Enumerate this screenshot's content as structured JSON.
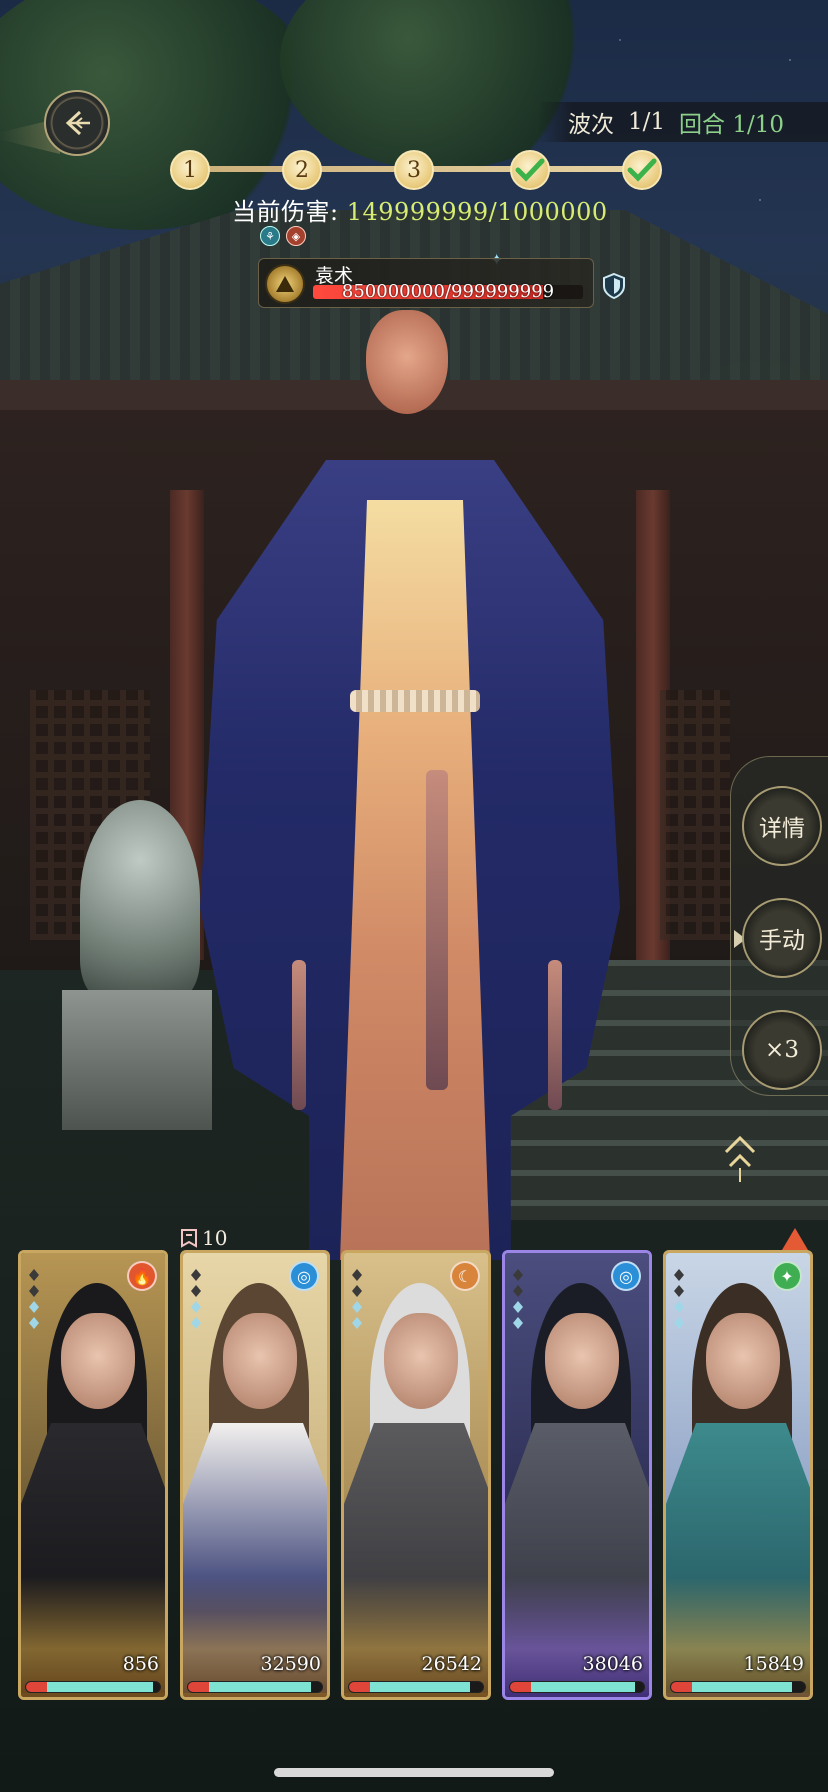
{
  "hud": {
    "wave_label": "波次",
    "wave_value": "1/1",
    "round_label": "回合 1/10",
    "stages": [
      {
        "label": "1",
        "cleared": false
      },
      {
        "label": "2",
        "cleared": false
      },
      {
        "label": "3",
        "cleared": false
      },
      {
        "label": "",
        "cleared": true
      },
      {
        "label": "",
        "cleared": true
      }
    ],
    "damage_label": "当前伤害:",
    "damage_value": "149999999/1000000"
  },
  "boss": {
    "name": "袁术",
    "hp_text": "850000000/999999999",
    "hp_fraction": 0.85
  },
  "side_controls": {
    "details_label": "详情",
    "manual_label": "手动",
    "speed_label": "×3"
  },
  "team": {
    "rank_value": "10",
    "cards": [
      {
        "power": "856",
        "element": "fire",
        "element_glyph": "🔥",
        "hp_fraction": 0.95,
        "frame": "gold"
      },
      {
        "power": "32590",
        "element": "water",
        "element_glyph": "◎",
        "hp_fraction": 0.92,
        "frame": "gold"
      },
      {
        "power": "26542",
        "element": "moon",
        "element_glyph": "☾",
        "hp_fraction": 0.9,
        "frame": "gold"
      },
      {
        "power": "38046",
        "element": "water",
        "element_glyph": "◎",
        "hp_fraction": 0.93,
        "frame": "purple"
      },
      {
        "power": "15849",
        "element": "wind",
        "element_glyph": "✦",
        "hp_fraction": 0.9,
        "frame": "gold"
      }
    ]
  },
  "colors": {
    "damage_value": "#d7ec72",
    "round_text": "#8cd08a",
    "boss_hp": "#ff4a3e",
    "card_hp_teal": "#7ee3d2"
  }
}
